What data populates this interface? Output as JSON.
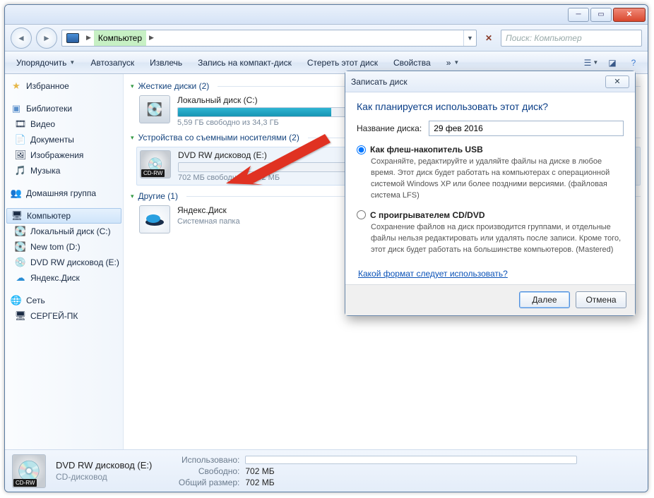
{
  "window": {
    "breadcrumb_label": "Компьютер",
    "search_placeholder": "Поиск: Компьютер"
  },
  "toolbar": {
    "organize": "Упорядочить",
    "autoplay": "Автозапуск",
    "eject": "Извлечь",
    "burn": "Запись на компакт-диск",
    "erase": "Стереть этот диск",
    "properties": "Свойства"
  },
  "sidebar": {
    "favorites": "Избранное",
    "libraries": "Библиотеки",
    "videos": "Видео",
    "documents": "Документы",
    "pictures": "Изображения",
    "music": "Музыка",
    "homegroup": "Домашняя группа",
    "computer": "Компьютер",
    "local_c": "Локальный диск (C:)",
    "new_tom": "New tom (D:)",
    "dvd_e": "DVD RW дисковод (E:)",
    "yandex": "Яндекс.Диск",
    "network": "Сеть",
    "sergey_pc": "СЕРГЕЙ-ПК"
  },
  "main": {
    "hdd_header": "Жесткие диски (2)",
    "removable_header": "Устройства со съемными носителями (2)",
    "other_header": "Другие (1)",
    "drive_c": {
      "name": "Локальный диск (C:)",
      "sub": "5,59 ГБ свободно из 34,3 ГБ",
      "pct": 84
    },
    "dvd": {
      "name": "DVD RW дисковод (E:)",
      "sub": "702 МБ свободно из 702 МБ",
      "badge": "CD-RW",
      "pct": 0
    },
    "yandex": {
      "name": "Яндекс.Диск",
      "sub": "Системная папка"
    }
  },
  "status": {
    "title": "DVD RW дисковод (E:)",
    "subtitle": "CD-дисковод",
    "used_lbl": "Использовано:",
    "free_lbl": "Свободно:",
    "free_val": "702 МБ",
    "total_lbl": "Общий размер:",
    "total_val": "702 МБ"
  },
  "dialog": {
    "title": "Записать диск",
    "question": "Как планируется использовать этот диск?",
    "name_lbl": "Название диска:",
    "name_val": "29 фев 2016",
    "opt1_title": "Как флеш-накопитель USB",
    "opt1_desc": "Сохраняйте, редактируйте и удаляйте файлы на диске в любое время. Этот диск будет работать на компьютерах с операционной системой Windows XP или более поздними версиями. (файловая система LFS)",
    "opt2_title": "С проигрывателем CD/DVD",
    "opt2_desc": "Сохранение файлов на диск производится группами, и отдельные файлы нельзя редактировать или удалять после записи. Кроме того, этот диск будет работать на большинстве компьютеров. (Mastered)",
    "help_link": "Какой формат следует использовать?",
    "next": "Далее",
    "cancel": "Отмена"
  }
}
